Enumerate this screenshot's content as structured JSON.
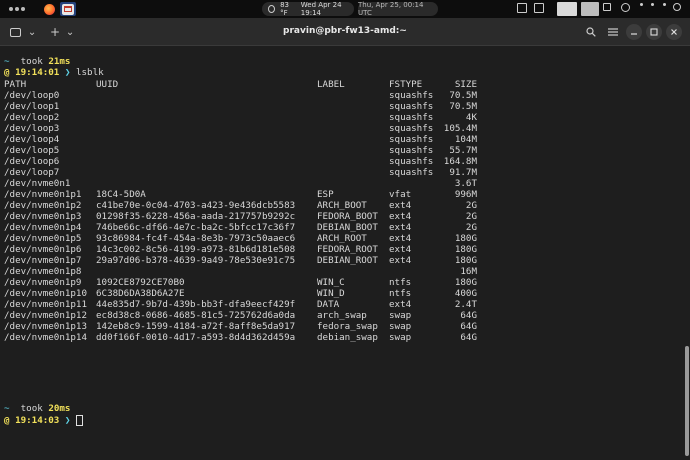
{
  "topbar": {
    "weather": "83 °F",
    "clock": "Wed Apr 24  19:14",
    "utc_date": "Thu, Apr 25, 00:14 UTC"
  },
  "terminal": {
    "title": "pravin@pbr-fw13-amd:~",
    "new_tab": "+",
    "menu_chevron": "⌄",
    "prompt_symbol": "~",
    "took_label": "took",
    "chevron": "❯",
    "first": {
      "duration": "21ms",
      "time": "@ 19:14:01",
      "command": "lsblk"
    },
    "second": {
      "duration": "20ms",
      "time": "@ 19:14:03"
    }
  },
  "table": {
    "headers": [
      "PATH",
      "UUID",
      "LABEL",
      "FSTYPE",
      "SIZE"
    ],
    "rows": [
      [
        "/dev/loop0",
        "",
        "",
        "squashfs",
        "70.5M"
      ],
      [
        "/dev/loop1",
        "",
        "",
        "squashfs",
        "70.5M"
      ],
      [
        "/dev/loop2",
        "",
        "",
        "squashfs",
        "4K"
      ],
      [
        "/dev/loop3",
        "",
        "",
        "squashfs",
        "105.4M"
      ],
      [
        "/dev/loop4",
        "",
        "",
        "squashfs",
        "104M"
      ],
      [
        "/dev/loop5",
        "",
        "",
        "squashfs",
        "55.7M"
      ],
      [
        "/dev/loop6",
        "",
        "",
        "squashfs",
        "164.8M"
      ],
      [
        "/dev/loop7",
        "",
        "",
        "squashfs",
        "91.7M"
      ],
      [
        "/dev/nvme0n1",
        "",
        "",
        "",
        "3.6T"
      ],
      [
        "/dev/nvme0n1p1",
        "18C4-5D0A",
        "ESP",
        "vfat",
        "996M"
      ],
      [
        "/dev/nvme0n1p2",
        "c41be70e-0c04-4703-a423-9e436dcb5583",
        "ARCH_BOOT",
        "ext4",
        "2G"
      ],
      [
        "/dev/nvme0n1p3",
        "01298f35-6228-456a-aada-217757b9292c",
        "FEDORA_BOOT",
        "ext4",
        "2G"
      ],
      [
        "/dev/nvme0n1p4",
        "746be66c-df66-4e7c-ba2c-5bfcc17c36f7",
        "DEBIAN_BOOT",
        "ext4",
        "2G"
      ],
      [
        "/dev/nvme0n1p5",
        "93c86984-fc4f-454a-8e3b-7973c50aaec6",
        "ARCH_ROOT",
        "ext4",
        "180G"
      ],
      [
        "/dev/nvme0n1p6",
        "14c3c002-8c56-4199-a973-81b6d181e508",
        "FEDORA_ROOT",
        "ext4",
        "180G"
      ],
      [
        "/dev/nvme0n1p7",
        "29a97d06-b378-4639-9a49-78e530e91c75",
        "DEBIAN_ROOT",
        "ext4",
        "180G"
      ],
      [
        "/dev/nvme0n1p8",
        "",
        "",
        "",
        "16M"
      ],
      [
        "/dev/nvme0n1p9",
        "1092CE8792CE70B0",
        "WIN_C",
        "ntfs",
        "180G"
      ],
      [
        "/dev/nvme0n1p10",
        "6C38D6DA38D6A27E",
        "WIN_D",
        "ntfs",
        "400G"
      ],
      [
        "/dev/nvme0n1p11",
        "44e835d7-9b7d-439b-bb3f-dfa9eecf429f",
        "DATA",
        "ext4",
        "2.4T"
      ],
      [
        "/dev/nvme0n1p12",
        "ec8d38c8-0686-4685-81c5-725762d6a0da",
        "arch_swap",
        "swap",
        "64G"
      ],
      [
        "/dev/nvme0n1p13",
        "142eb8c9-1599-4184-a72f-8aff8e5da917",
        "fedora_swap",
        "swap",
        "64G"
      ],
      [
        "/dev/nvme0n1p14",
        "dd0f166f-0010-4d17-a593-8d4d362d459a",
        "debian_swap",
        "swap",
        "64G"
      ]
    ]
  }
}
